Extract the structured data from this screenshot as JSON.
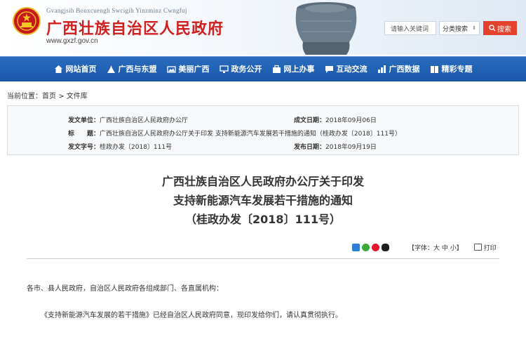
{
  "header": {
    "latin_name": "Gvangjsih Bouxcuengh Swcigih Yinzminz Cwngfuj",
    "title": "广西壮族自治区人民政府",
    "url": "www.gxzf.gov.cn",
    "emblem_icon": "national-emblem-icon",
    "title_color": "#d01f1f"
  },
  "search": {
    "placeholder": "请输入关键词",
    "category": "分类搜索",
    "button": "搜索",
    "button_color": "#e3432d"
  },
  "nav": {
    "color": "#1f60b2",
    "items": [
      {
        "label": "网站首页",
        "icon": "home-icon"
      },
      {
        "label": "广西与东盟",
        "icon": "landmark-icon"
      },
      {
        "label": "美丽广西",
        "icon": "scenery-icon"
      },
      {
        "label": "政务公开",
        "icon": "monitor-icon"
      },
      {
        "label": "网上办事",
        "icon": "briefcase-icon"
      },
      {
        "label": "互动交流",
        "icon": "chat-icon"
      },
      {
        "label": "广西数据",
        "icon": "chart-icon"
      },
      {
        "label": "精彩专题",
        "icon": "book-icon"
      }
    ]
  },
  "breadcrumb": {
    "prefix": "当前位置：",
    "home": "首页",
    "separator": ">",
    "current": "文件库"
  },
  "info": {
    "issuer_label": "发文单位：",
    "issuer": "广西壮族自治区人民政府办公厅",
    "written_label": "成文日期：",
    "written_date": "2018年09月06日",
    "title_label": "标　　题：",
    "title": "广西壮族自治区人民政府办公厅关于印发 支持新能源汽车发展若干措施的通知（桂政办发〔2018〕111号）",
    "docno_label": "发文字号：",
    "docno": "桂政办发〔2018〕111号",
    "published_label": "发布日期：",
    "published_date": "2018年09月19日"
  },
  "document": {
    "title_line1": "广西壮族自治区人民政府办公厅关于印发",
    "title_line2": "支持新能源汽车发展若干措施的通知",
    "title_line3": "（桂政办发〔2018〕111号）",
    "font_label": "【字体：大 中 小】",
    "print_label": "打印",
    "share_icons": [
      "qzone-share-icon",
      "wechat-share-icon",
      "weibo-share-icon",
      "qq-share-icon"
    ],
    "para1": "各市、县人民政府，自治区人民政府各组成部门、各直属机构：",
    "para2": "《支持新能源汽车发展的若干措施》已经自治区人民政府同意，现印发给你们，请认真贯彻执行。"
  }
}
